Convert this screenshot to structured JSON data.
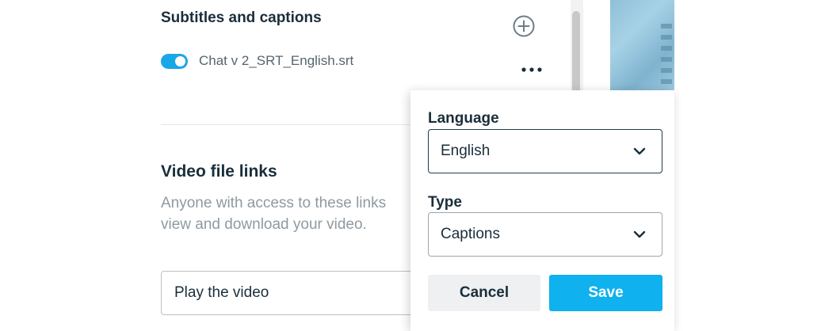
{
  "subtitles": {
    "title": "Subtitles and captions",
    "add_icon": "plus-circle-icon",
    "file": {
      "name": "Chat v 2_SRT_English.srt",
      "enabled": true,
      "menu_icon": "more-horizontal-icon"
    }
  },
  "video_links": {
    "title": "Video file links",
    "description_line1": "Anyone with access to these links",
    "description_line2": "view and download your video.",
    "play_field_value": "Play the video"
  },
  "popover": {
    "language_label": "Language",
    "language_value": "English",
    "type_label": "Type",
    "type_value": "Captions",
    "cancel_label": "Cancel",
    "save_label": "Save"
  },
  "colors": {
    "accent": "#0fb1ee",
    "toggle_on": "#1aa7e8",
    "text_primary": "#1a2e3b",
    "text_muted": "#8e9aa1"
  }
}
